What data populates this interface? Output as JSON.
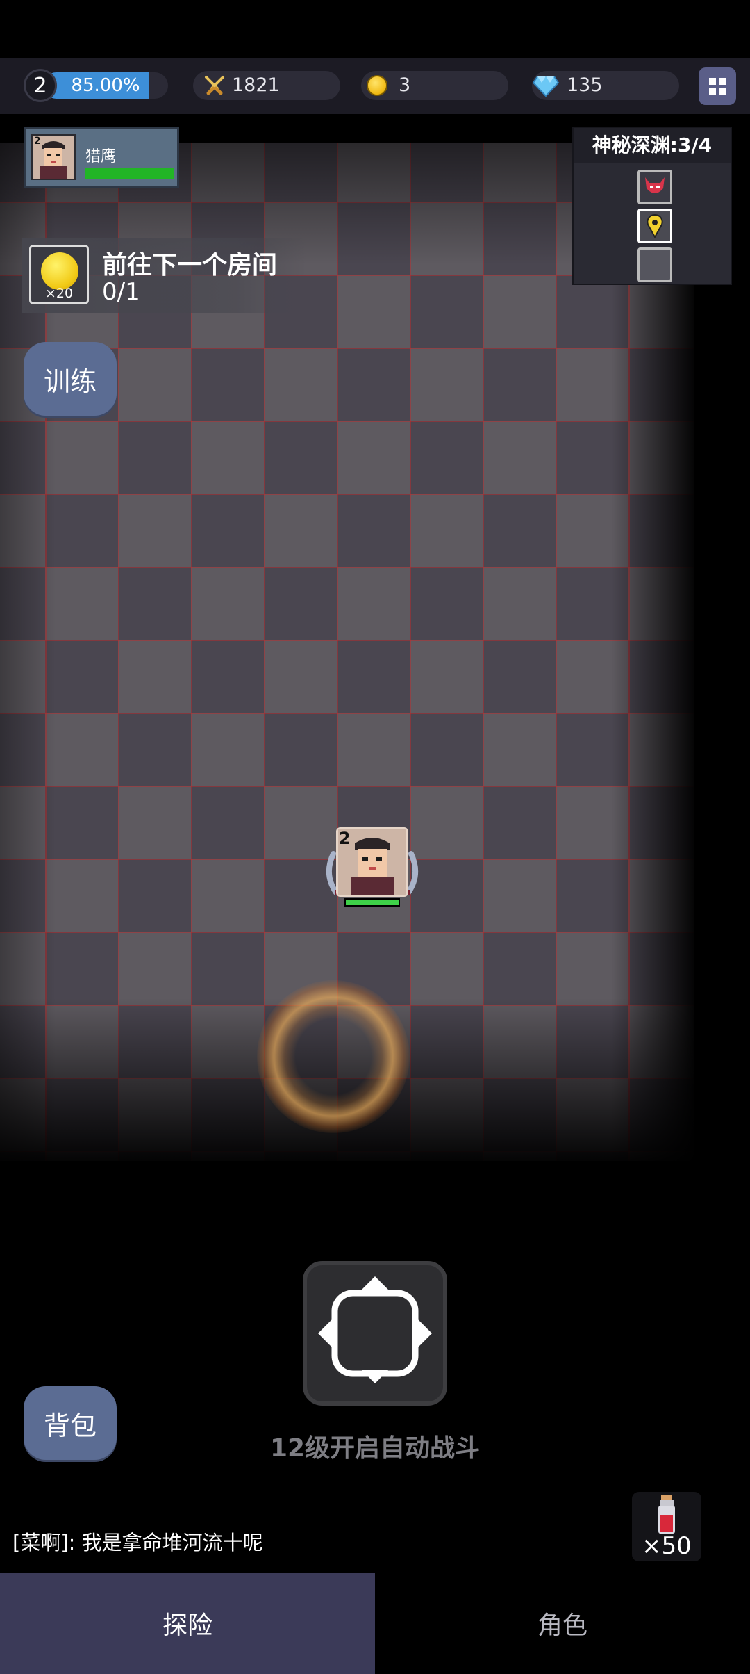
{
  "status_bar": {
    "level": "2",
    "xp_percent": "85.00%",
    "xp_fraction": 0.85,
    "power": "1821",
    "coins": "3",
    "gems": "135"
  },
  "hero": {
    "level": "2",
    "name": "猎鹰",
    "hp_fraction": 1.0
  },
  "quest": {
    "reward_qty": "×20",
    "title": "前往下一个房间",
    "progress": "0/1"
  },
  "dungeon": {
    "title": "神秘深渊:3/4",
    "rooms": [
      "boss-icon",
      "location-pin-icon",
      "empty-room"
    ]
  },
  "buttons": {
    "train": "训练",
    "bag": "背包"
  },
  "unit": {
    "level": "2",
    "hp_fraction": 1.0
  },
  "auto_battle": {
    "label": "12级开启自动战斗"
  },
  "chat": {
    "message": "[菜啊]: 我是拿命堆河流十呢"
  },
  "potion": {
    "qty": "×50"
  },
  "tabs": [
    {
      "label": "探险",
      "active": true
    },
    {
      "label": "角色",
      "active": false
    }
  ],
  "colors": {
    "xp_bar": "#3d8fd8",
    "hp_green": "#22b526",
    "button_blue": "#5b6c93",
    "active_tab": "#3b3a58"
  }
}
